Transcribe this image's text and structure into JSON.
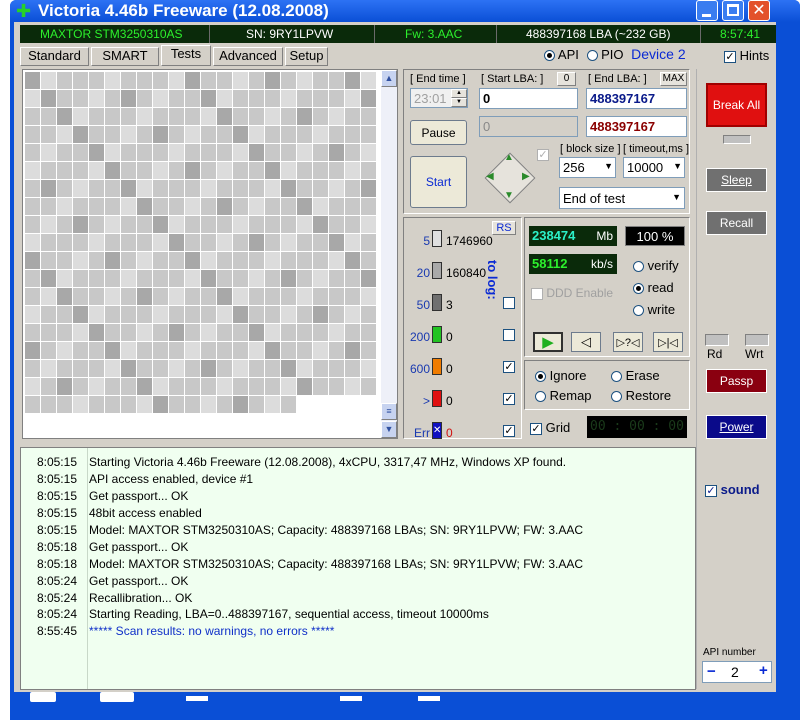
{
  "window": {
    "title": "Victoria 4.46b Freeware (12.08.2008)",
    "controls": [
      "minimize",
      "maximize",
      "close"
    ]
  },
  "infobar": {
    "model": "MAXTOR STM3250310AS",
    "serial": "SN: 9RY1LPVW",
    "firmware": "Fw: 3.AAC",
    "capacity": "488397168 LBA (~232 GB)",
    "clock": "8:57:41"
  },
  "tabs": [
    "Standard",
    "SMART",
    "Tests",
    "Advanced",
    "Setup"
  ],
  "active_tab": "Tests",
  "mode": {
    "api": "API",
    "pio": "PIO",
    "device": "Device 2",
    "hints": "Hints"
  },
  "test": {
    "end_time_label": "[ End time ]",
    "end_time_value": "23:01",
    "start_lba_label": "[ Start LBA: ]",
    "start_lba_zero": "0",
    "start_lba_value": "0",
    "end_lba_label": "[ End LBA: ]",
    "end_lba_max": "MAX",
    "end_lba_value": "488397167",
    "current_value": "0",
    "current_end": "488397167",
    "pause": "Pause",
    "start": "Start",
    "block_size_label": "[ block size ]",
    "block_size": "256",
    "timeout_label": "[ timeout,ms ]",
    "timeout": "10000",
    "end_mode": "End of test"
  },
  "stats": {
    "rs": "RS",
    "to_log": "to log:",
    "rows": [
      {
        "threshold": "5",
        "count": "1746960",
        "color": "#e0e0e0",
        "checked": false,
        "enabled": false
      },
      {
        "threshold": "20",
        "count": "160840",
        "color": "#a9a9a9",
        "checked": false,
        "enabled": false
      },
      {
        "threshold": "50",
        "count": "3",
        "color": "#707070",
        "checked": false,
        "enabled": true
      },
      {
        "threshold": "200",
        "count": "0",
        "color": "#22c322",
        "checked": false,
        "enabled": true
      },
      {
        "threshold": "600",
        "count": "0",
        "color": "#f07c00",
        "checked": true,
        "enabled": true
      },
      {
        "threshold": ">",
        "count": "0",
        "color": "#e01010",
        "checked": true,
        "enabled": true
      },
      {
        "threshold": "Err",
        "count": "0",
        "color": "#1010c0",
        "checked": true,
        "enabled": true
      }
    ]
  },
  "progress": {
    "mb": "238474",
    "mb_unit": "Mb",
    "percent": "100",
    "percent_unit": "%",
    "speed": "58112",
    "speed_unit": "kb/s",
    "ddd": "DDD Enable",
    "verify": "verify",
    "read": "read",
    "write": "write"
  },
  "actions": {
    "ignore": "Ignore",
    "erase": "Erase",
    "remap": "Remap",
    "restore": "Restore",
    "grid": "Grid",
    "timer": "00 : 00 : 00"
  },
  "right_panel": {
    "break_all": "Break All",
    "sleep": "Sleep",
    "recall": "Recall",
    "rd": "Rd",
    "wrt": "Wrt",
    "passp": "Passp",
    "power": "Power",
    "sound": "sound",
    "api_number_label": "API number",
    "api_number": "2",
    "minus": "−",
    "plus": "+"
  },
  "log": [
    {
      "time": "8:05:15",
      "msg": "Starting Victoria 4.46b Freeware (12.08.2008), 4xCPU, 3317,47 MHz, Windows XP found.",
      "blue": false
    },
    {
      "time": "8:05:15",
      "msg": "API access enabled, device #1",
      "blue": false
    },
    {
      "time": "8:05:15",
      "msg": "Get passport... OK",
      "blue": false
    },
    {
      "time": "8:05:15",
      "msg": "48bit access enabled",
      "blue": false
    },
    {
      "time": "8:05:15",
      "msg": "Model: MAXTOR STM3250310AS; Capacity: 488397168 LBAs; SN: 9RY1LPVW; FW: 3.AAC",
      "blue": false
    },
    {
      "time": "8:05:18",
      "msg": "Get passport... OK",
      "blue": false
    },
    {
      "time": "8:05:18",
      "msg": "Model: MAXTOR STM3250310AS; Capacity: 488397168 LBAs; SN: 9RY1LPVW; FW: 3.AAC",
      "blue": false
    },
    {
      "time": "8:05:24",
      "msg": "Get passport... OK",
      "blue": false
    },
    {
      "time": "8:05:24",
      "msg": "Recallibration... OK",
      "blue": false
    },
    {
      "time": "8:05:24",
      "msg": "Starting Reading, LBA=0..488397167, sequential access, timeout 10000ms",
      "blue": false
    },
    {
      "time": "8:55:45",
      "msg": "***** Scan results: no warnings, no errors *****",
      "blue": true
    }
  ],
  "colors": {
    "titlebar": "#0a4fd6",
    "infobar": "#0a2a0a",
    "infotext": "#2cf02c",
    "panel": "#d4d0c8",
    "log_bg": "#f0fff0",
    "break": "#e01010"
  }
}
